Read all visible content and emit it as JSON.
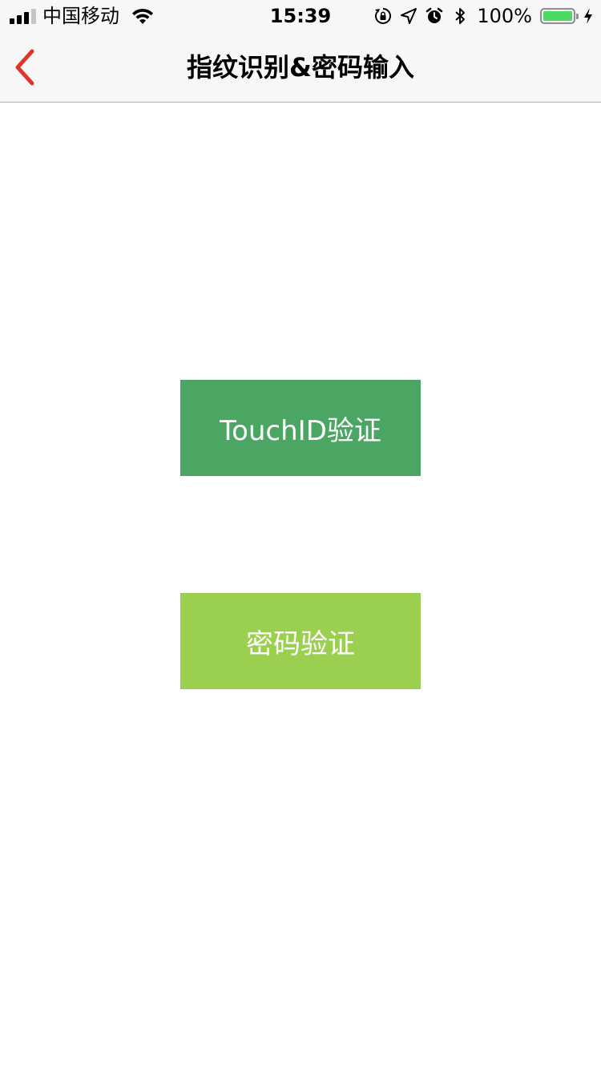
{
  "status_bar": {
    "carrier": "中国移动",
    "time": "15:39",
    "battery_percent": "100%",
    "battery_level": 1.0,
    "signal_bars_filled": 3,
    "signal_bars_total": 4,
    "icons": [
      "signal-icon",
      "wifi-icon",
      "rotation-lock-icon",
      "location-icon",
      "alarm-icon",
      "bluetooth-icon",
      "battery-icon",
      "charging-icon"
    ]
  },
  "nav_bar": {
    "title": "指纹识别&密码输入",
    "back_icon": "chevron-left-icon",
    "back_color": "#e0352b"
  },
  "main": {
    "touchid_button": {
      "label": "TouchID验证",
      "color": "#4ba563"
    },
    "password_button": {
      "label": "密码验证",
      "color": "#9bcf4f"
    }
  }
}
